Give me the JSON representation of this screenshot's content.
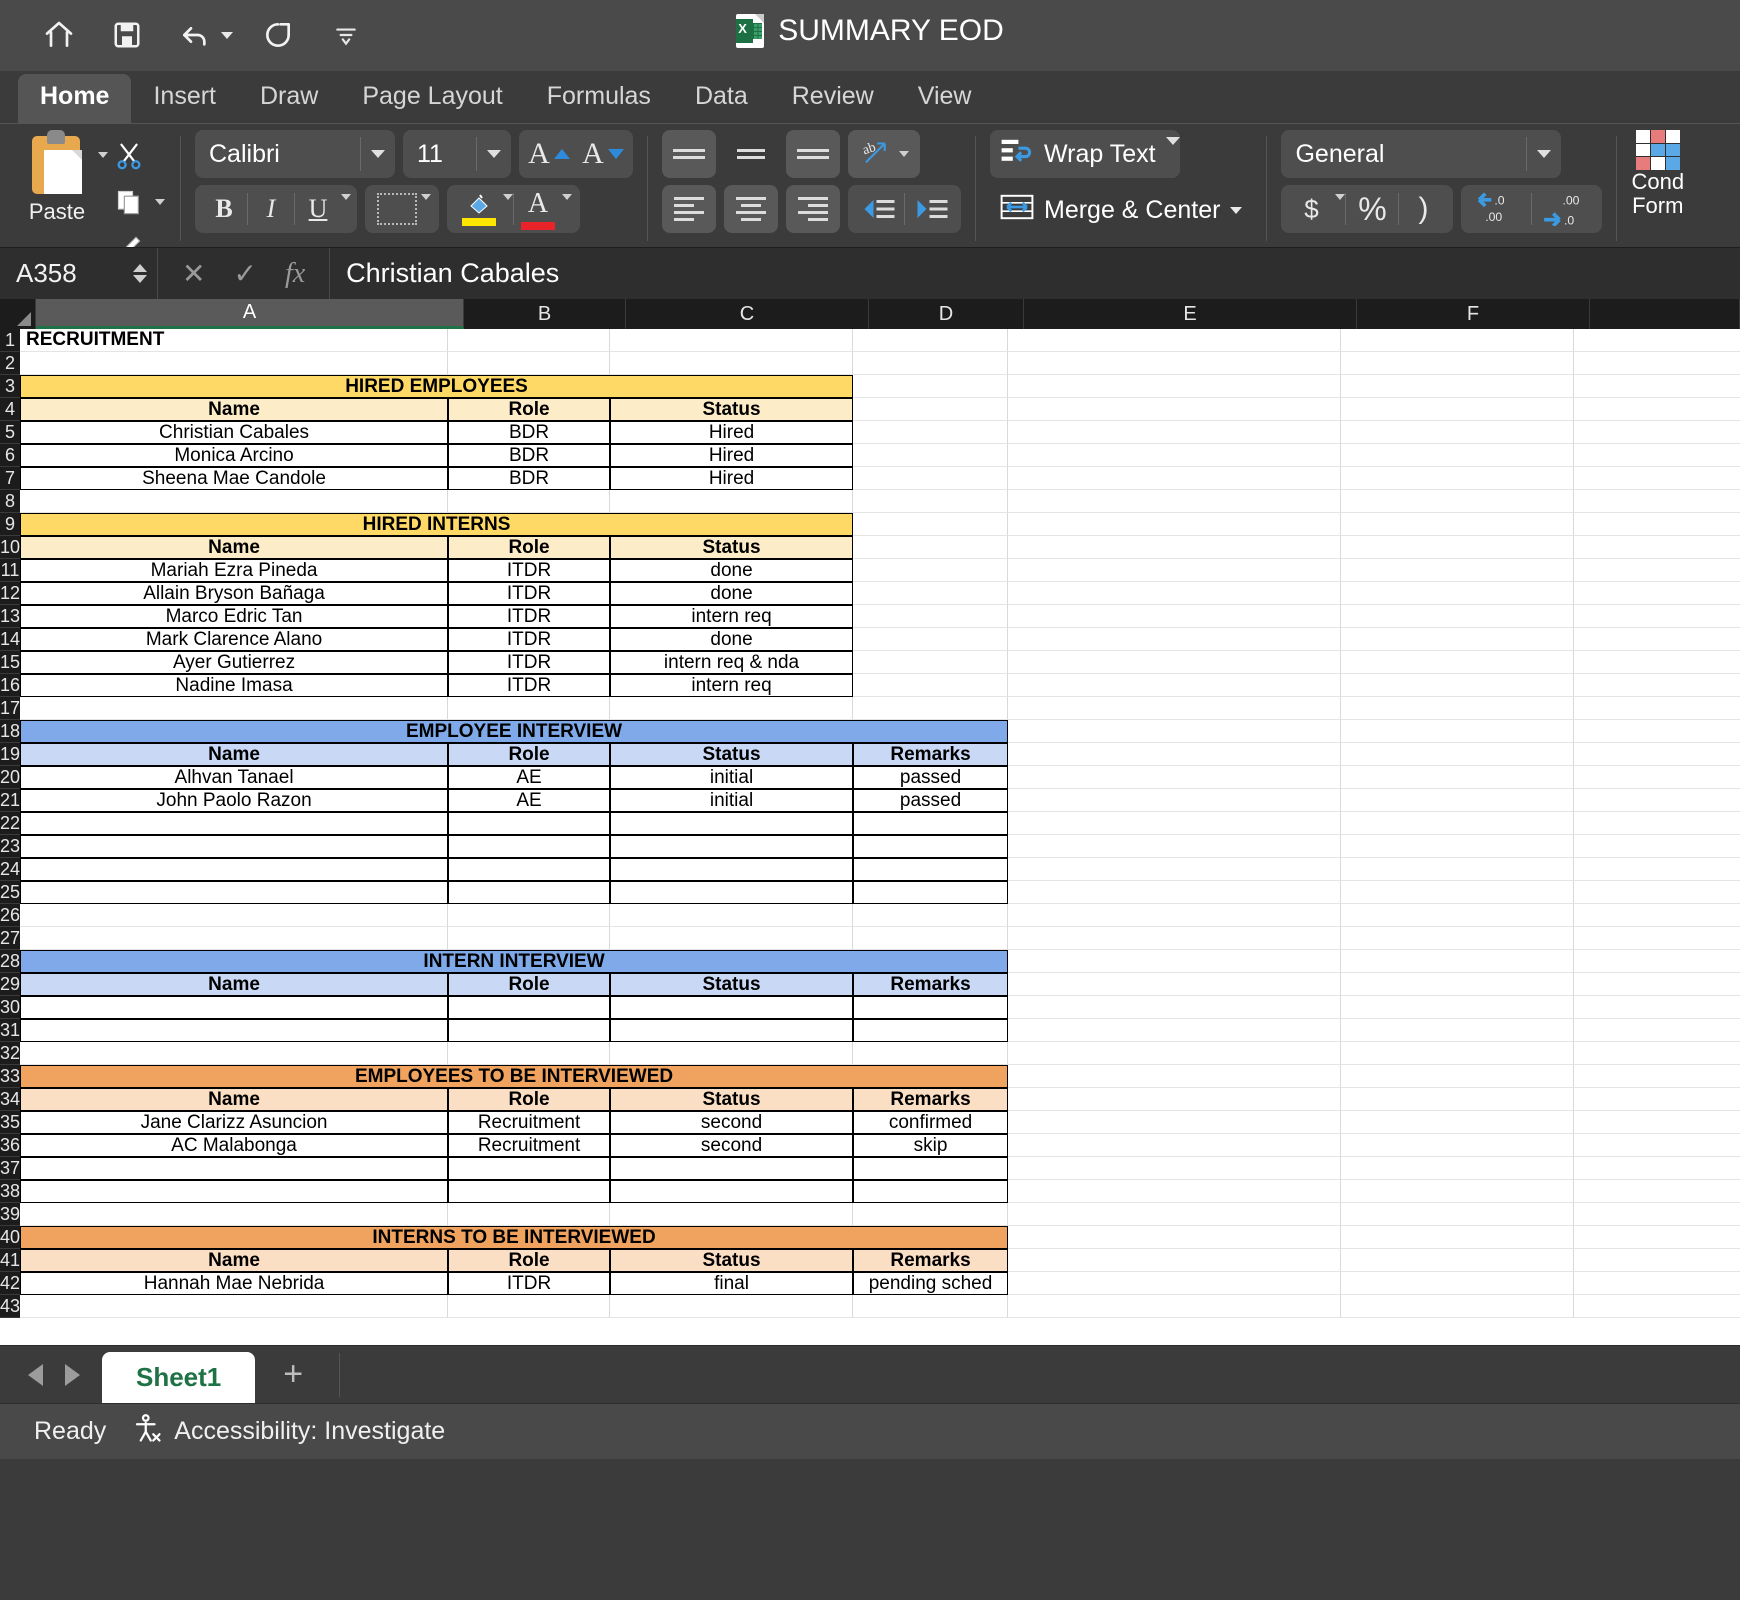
{
  "titlebar": {
    "document_title": "SUMMARY EOD",
    "quick_access": [
      {
        "name": "home-icon",
        "label": "Home"
      },
      {
        "name": "save-icon",
        "label": "Save"
      },
      {
        "name": "undo-icon",
        "label": "Undo"
      },
      {
        "name": "redo-icon",
        "label": "Redo"
      },
      {
        "name": "customize-toolbar-icon",
        "label": "Customize Quick Access Toolbar"
      }
    ]
  },
  "ribbon": {
    "tabs": [
      {
        "label": "Home",
        "active": true
      },
      {
        "label": "Insert",
        "active": false
      },
      {
        "label": "Draw",
        "active": false
      },
      {
        "label": "Page Layout",
        "active": false
      },
      {
        "label": "Formulas",
        "active": false
      },
      {
        "label": "Data",
        "active": false
      },
      {
        "label": "Review",
        "active": false
      },
      {
        "label": "View",
        "active": false
      }
    ],
    "clipboard": {
      "paste_label": "Paste",
      "cut_label": "Cut",
      "copy_label": "Copy",
      "format_painter_label": "Format Painter"
    },
    "font": {
      "family": "Calibri",
      "size": "11",
      "grow_label": "A",
      "shrink_label": "A",
      "bold_label": "B",
      "italic_label": "I",
      "underline_label": "U",
      "borders_label": "Borders",
      "fill_color": "#ffe600",
      "font_color": "#e8232a",
      "font_color_label": "A"
    },
    "alignment": {
      "top_align_label": "Top Align",
      "middle_align_label": "Middle Align",
      "bottom_align_label": "Bottom Align",
      "orientation_label": "ab",
      "align_left_label": "Align Left",
      "center_label": "Center",
      "align_right_label": "Align Right",
      "decrease_indent_label": "Decrease Indent",
      "increase_indent_label": "Increase Indent",
      "wrap_text_label": "Wrap Text",
      "merge_center_label": "Merge & Center"
    },
    "number": {
      "format": "General",
      "currency_label": "$",
      "percent_label": "%",
      "comma_label": ")",
      "increase_decimal_label": ".00",
      "decrease_decimal_label": ".0"
    },
    "styles": {
      "conditional_formatting_label_line1": "Cond",
      "conditional_formatting_label_line2": "Form"
    }
  },
  "formula_bar": {
    "name_box": "A358",
    "cancel_label": "✕",
    "enter_label": "✓",
    "fx_label": "fx",
    "content": "Christian Cabales"
  },
  "grid": {
    "columns": [
      {
        "label": "A",
        "selected": true
      },
      {
        "label": "B",
        "selected": false
      },
      {
        "label": "C",
        "selected": false
      },
      {
        "label": "D",
        "selected": false
      },
      {
        "label": "E",
        "selected": false
      },
      {
        "label": "F",
        "selected": false
      }
    ],
    "rows": [
      "1",
      "2",
      "3",
      "4",
      "5",
      "6",
      "7",
      "8",
      "9",
      "10",
      "11",
      "12",
      "13",
      "14",
      "15",
      "16",
      "17",
      "18",
      "19",
      "20",
      "21",
      "22",
      "23",
      "24",
      "25",
      "26",
      "27",
      "28",
      "29",
      "30",
      "31",
      "32",
      "33",
      "34",
      "35",
      "36",
      "37",
      "38",
      "39",
      "40",
      "41",
      "42",
      "43"
    ],
    "colors": {
      "yellow_band": "#ffd966",
      "yellow_header": "#fdecc8",
      "blue_band": "#7fa9e8",
      "blue_header": "#c9d8f4",
      "orange_band": "#f2a濃"
    },
    "cells": {
      "a1": "RECRUITMENT"
    },
    "sections": [
      {
        "title": "HIRED EMPLOYEES",
        "title_row": "3",
        "theme": "yellow",
        "columns": [
          "Name",
          "Role",
          "Status"
        ],
        "header_row": "4",
        "rows": [
          {
            "row": "5",
            "values": [
              "Christian Cabales",
              "BDR",
              "Hired"
            ]
          },
          {
            "row": "6",
            "values": [
              "Monica Arcino",
              "BDR",
              "Hired"
            ]
          },
          {
            "row": "7",
            "values": [
              "Sheena Mae Candole",
              "BDR",
              "Hired"
            ]
          }
        ]
      },
      {
        "title": "HIRED INTERNS",
        "title_row": "9",
        "theme": "yellow",
        "columns": [
          "Name",
          "Role",
          "Status"
        ],
        "header_row": "10",
        "rows": [
          {
            "row": "11",
            "values": [
              "Mariah Ezra Pineda",
              "ITDR",
              "done"
            ]
          },
          {
            "row": "12",
            "values": [
              "Allain Bryson Bañaga",
              "ITDR",
              "done"
            ]
          },
          {
            "row": "13",
            "values": [
              "Marco Edric Tan",
              "ITDR",
              "intern req"
            ]
          },
          {
            "row": "14",
            "values": [
              "Mark Clarence Alano",
              "ITDR",
              "done"
            ]
          },
          {
            "row": "15",
            "values": [
              "Ayer Gutierrez",
              "ITDR",
              "intern req & nda"
            ]
          },
          {
            "row": "16",
            "values": [
              "Nadine Imasa",
              "ITDR",
              "intern req"
            ]
          }
        ]
      },
      {
        "title": "EMPLOYEE INTERVIEW",
        "title_row": "18",
        "theme": "blue",
        "columns": [
          "Name",
          "Role",
          "Status",
          "Remarks"
        ],
        "header_row": "19",
        "rows": [
          {
            "row": "20",
            "values": [
              "Alhvan Tanael",
              "AE",
              "initial",
              "passed"
            ]
          },
          {
            "row": "21",
            "values": [
              "John Paolo Razon",
              "AE",
              "initial",
              "passed"
            ]
          },
          {
            "row": "22",
            "values": [
              "",
              "",
              "",
              ""
            ]
          },
          {
            "row": "23",
            "values": [
              "",
              "",
              "",
              ""
            ]
          },
          {
            "row": "24",
            "values": [
              "",
              "",
              "",
              ""
            ]
          },
          {
            "row": "25",
            "values": [
              "",
              "",
              "",
              ""
            ]
          }
        ]
      },
      {
        "title": "INTERN INTERVIEW",
        "title_row": "28",
        "theme": "blue",
        "columns": [
          "Name",
          "Role",
          "Status",
          "Remarks"
        ],
        "header_row": "29",
        "rows": [
          {
            "row": "30",
            "values": [
              "",
              "",
              "",
              ""
            ]
          },
          {
            "row": "31",
            "values": [
              "",
              "",
              "",
              ""
            ]
          }
        ]
      },
      {
        "title": "EMPLOYEES TO BE INTERVIEWED",
        "title_row": "33",
        "theme": "orange",
        "columns": [
          "Name",
          "Role",
          "Status",
          "Remarks"
        ],
        "header_row": "34",
        "rows": [
          {
            "row": "35",
            "values": [
              "Jane Clarizz Asuncion",
              "Recruitment",
              "second",
              "confirmed"
            ]
          },
          {
            "row": "36",
            "values": [
              "AC Malabonga",
              "Recruitment",
              "second",
              "skip"
            ]
          },
          {
            "row": "37",
            "values": [
              "",
              "",
              "",
              ""
            ]
          },
          {
            "row": "38",
            "values": [
              "",
              "",
              "",
              ""
            ]
          }
        ]
      },
      {
        "title": "INTERNS TO BE INTERVIEWED",
        "title_row": "40",
        "theme": "orange",
        "columns": [
          "Name",
          "Role",
          "Status",
          "Remarks"
        ],
        "header_row": "41",
        "rows": [
          {
            "row": "42",
            "values": [
              "Hannah Mae Nebrida",
              "ITDR",
              "final",
              "pending sched"
            ]
          }
        ]
      }
    ]
  },
  "sheet_bar": {
    "prev_label": "Previous sheet",
    "next_label": "Next sheet",
    "tabs": [
      "Sheet1"
    ],
    "add_label": "+"
  },
  "status_bar": {
    "state": "Ready",
    "accessibility": "Accessibility: Investigate"
  }
}
